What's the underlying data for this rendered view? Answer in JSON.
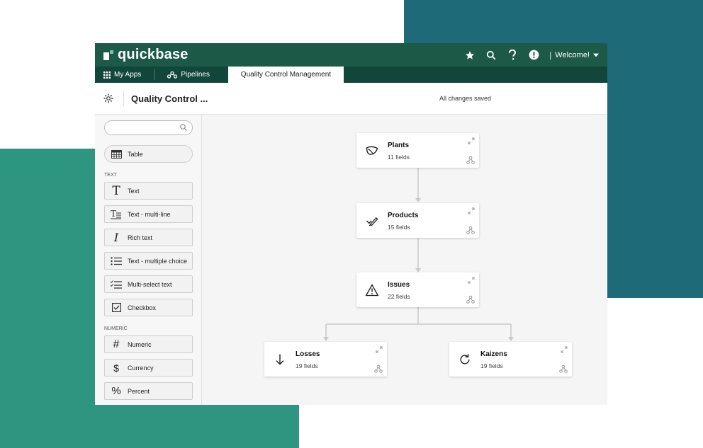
{
  "topbar": {
    "logo_text": "quickbase",
    "welcome_label": "Welcome!",
    "icons": [
      "star-icon",
      "search-icon",
      "help-icon",
      "alert-icon",
      "caret-down-icon"
    ]
  },
  "tabs": [
    {
      "label": "My Apps",
      "icon": "grid-icon"
    },
    {
      "label": "Pipelines",
      "icon": "pipelines-icon"
    },
    {
      "label": "Quality Control Management",
      "active": true
    }
  ],
  "subheader": {
    "app_title": "Quality Control ...",
    "save_status": "All changes saved"
  },
  "sidebar": {
    "search_placeholder": "",
    "table_label": "Table",
    "sections": [
      {
        "label": "TEXT",
        "items": [
          {
            "label": "Text",
            "icon": "text-icon"
          },
          {
            "label": "Text - multi-line",
            "icon": "text-multiline-icon"
          },
          {
            "label": "Rich text",
            "icon": "italic-icon"
          },
          {
            "label": "Text - multiple choice",
            "icon": "list-icon"
          },
          {
            "label": "Multi-select text",
            "icon": "checklist-icon"
          },
          {
            "label": "Checkbox",
            "icon": "checkbox-icon"
          }
        ]
      },
      {
        "label": "NUMERIC",
        "items": [
          {
            "label": "Numeric",
            "icon": "hash-icon"
          },
          {
            "label": "Currency",
            "icon": "dollar-icon"
          },
          {
            "label": "Percent",
            "icon": "percent-icon"
          }
        ]
      }
    ]
  },
  "tables": [
    {
      "name": "Plants",
      "fields": "11 fields",
      "icon": "leaf-icon"
    },
    {
      "name": "Products",
      "fields": "15 fields",
      "icon": "pen-check-icon"
    },
    {
      "name": "Issues",
      "fields": "22 fields",
      "icon": "warning-icon"
    },
    {
      "name": "Losses",
      "fields": "19 fields",
      "icon": "arrow-down-icon"
    },
    {
      "name": "Kaizens",
      "fields": "19 fields",
      "icon": "refresh-icon"
    }
  ],
  "colors": {
    "topbar": "#1c5a47",
    "tabbar": "#13463a",
    "bg_teal_dark": "#1e6a78",
    "bg_teal_green": "#2e9580"
  }
}
